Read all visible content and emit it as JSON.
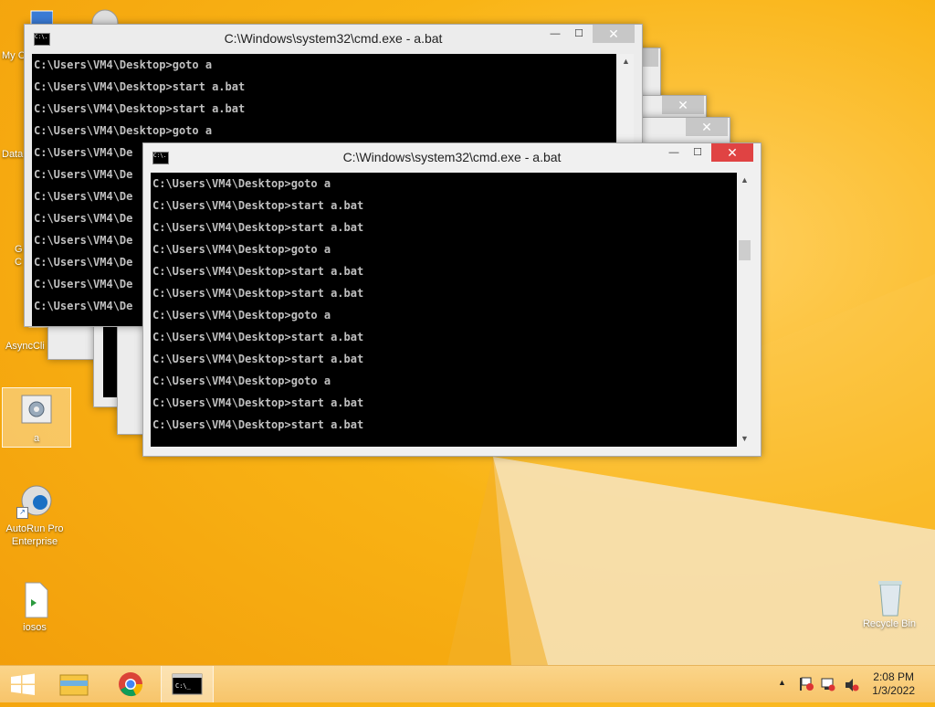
{
  "desktop": {
    "icons": [
      {
        "label": "My C"
      },
      {
        "label": "Data"
      },
      {
        "label": "G\nC"
      },
      {
        "label": "AsyncCli"
      },
      {
        "label": "a"
      },
      {
        "label": "AutoRun Pro Enterprise"
      },
      {
        "label": "iosos"
      },
      {
        "label": "Recycle Bin"
      }
    ]
  },
  "windows": {
    "back": {
      "title": "C:\\Windows\\system32\\cmd.exe - a.bat",
      "lines": [
        "C:\\Users\\VM4\\Desktop>goto a",
        "C:\\Users\\VM4\\Desktop>start a.bat",
        "C:\\Users\\VM4\\Desktop>start a.bat",
        "C:\\Users\\VM4\\Desktop>goto a",
        "C:\\Users\\VM4\\De",
        "C:\\Users\\VM4\\De",
        "C:\\Users\\VM4\\De",
        "C:\\Users\\VM4\\De",
        "C:\\Users\\VM4\\De",
        "C:\\Users\\VM4\\De",
        "C:\\Users\\VM4\\De",
        "C:\\Users\\VM4\\De"
      ]
    },
    "front": {
      "title": "C:\\Windows\\system32\\cmd.exe - a.bat",
      "lines": [
        "C:\\Users\\VM4\\Desktop>goto a",
        "C:\\Users\\VM4\\Desktop>start a.bat",
        "C:\\Users\\VM4\\Desktop>start a.bat",
        "C:\\Users\\VM4\\Desktop>goto a",
        "C:\\Users\\VM4\\Desktop>start a.bat",
        "C:\\Users\\VM4\\Desktop>start a.bat",
        "C:\\Users\\VM4\\Desktop>goto a",
        "C:\\Users\\VM4\\Desktop>start a.bat",
        "C:\\Users\\VM4\\Desktop>start a.bat",
        "C:\\Users\\VM4\\Desktop>goto a",
        "C:\\Users\\VM4\\Desktop>start a.bat",
        "C:\\Users\\VM4\\Desktop>start a.bat"
      ]
    },
    "controls": {
      "minimize": "—",
      "maximize": "☐",
      "close": "✕"
    },
    "console_icon": "C:\\."
  },
  "taskbar": {
    "pinned": [
      {
        "icon": "windows-start-icon"
      },
      {
        "icon": "file-explorer-icon"
      },
      {
        "icon": "chrome-icon"
      },
      {
        "icon": "cmd-icon"
      }
    ],
    "tray_arrow": "▲",
    "clock": {
      "time": "2:08 PM",
      "date": "1/3/2022"
    }
  },
  "colors": {
    "accent_close": "#e04343",
    "wallpaper": "#f9b415",
    "console_bg": "#000000"
  }
}
